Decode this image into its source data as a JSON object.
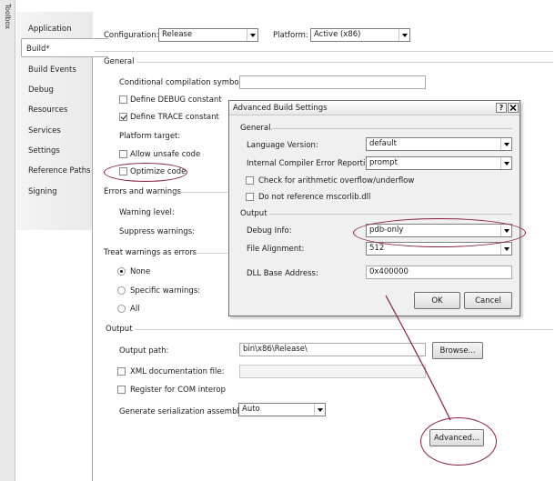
{
  "toolbox": {
    "label": "Toolbox"
  },
  "tabs": [
    {
      "label": "Application",
      "active": false
    },
    {
      "label": "Build*",
      "active": true
    },
    {
      "label": "Build Events",
      "active": false
    },
    {
      "label": "Debug",
      "active": false
    },
    {
      "label": "Resources",
      "active": false
    },
    {
      "label": "Services",
      "active": false
    },
    {
      "label": "Settings",
      "active": false
    },
    {
      "label": "Reference Paths",
      "active": false
    },
    {
      "label": "Signing",
      "active": false
    }
  ],
  "config_bar": {
    "configuration_label": "Configuration:",
    "configuration_value": "Release",
    "platform_label": "Platform:",
    "platform_value": "Active (x86)"
  },
  "general": {
    "heading": "General",
    "cond_symbols_label": "Conditional compilation symbols:",
    "cond_symbols_value": "",
    "define_debug_label": "Define DEBUG constant",
    "define_debug_checked": false,
    "define_trace_label": "Define TRACE constant",
    "define_trace_checked": true,
    "platform_target_label": "Platform target:",
    "allow_unsafe_label": "Allow unsafe code",
    "allow_unsafe_checked": false,
    "optimize_label": "Optimize code",
    "optimize_checked": false
  },
  "errors": {
    "heading": "Errors and warnings",
    "warning_level_label": "Warning level:",
    "suppress_label": "Suppress warnings:"
  },
  "treat_warnings": {
    "heading": "Treat warnings as errors",
    "none_label": "None",
    "specific_label": "Specific warnings:",
    "all_label": "All",
    "selected": "None"
  },
  "output": {
    "heading": "Output",
    "output_path_label": "Output path:",
    "output_path_value": "bin\\x86\\Release\\",
    "browse_label": "Browse...",
    "xml_doc_label": "XML documentation file:",
    "xml_doc_checked": false,
    "com_interop_label": "Register for COM interop",
    "com_interop_checked": false,
    "serialization_label": "Generate serialization assembly:",
    "serialization_value": "Auto",
    "advanced_label": "Advanced..."
  },
  "dialog": {
    "title": "Advanced Build Settings",
    "help_button": "?",
    "close_button": "X",
    "general_heading": "General",
    "language_version_label": "Language Version:",
    "language_version_value": "default",
    "ice_reporting_label": "Internal Compiler Error Reporting:",
    "ice_reporting_value": "prompt",
    "check_arith_label": "Check for arithmetic overflow/underflow",
    "check_arith_checked": false,
    "no_mscorlib_label": "Do not reference mscorlib.dll",
    "no_mscorlib_checked": false,
    "output_heading": "Output",
    "debug_info_label": "Debug Info:",
    "debug_info_value": "pdb-only",
    "file_alignment_label": "File Alignment:",
    "file_alignment_value": "512",
    "dll_base_label": "DLL Base Address:",
    "dll_base_value": "0x400000",
    "ok_label": "OK",
    "cancel_label": "Cancel"
  },
  "annotation_color": "#8b1d3c"
}
